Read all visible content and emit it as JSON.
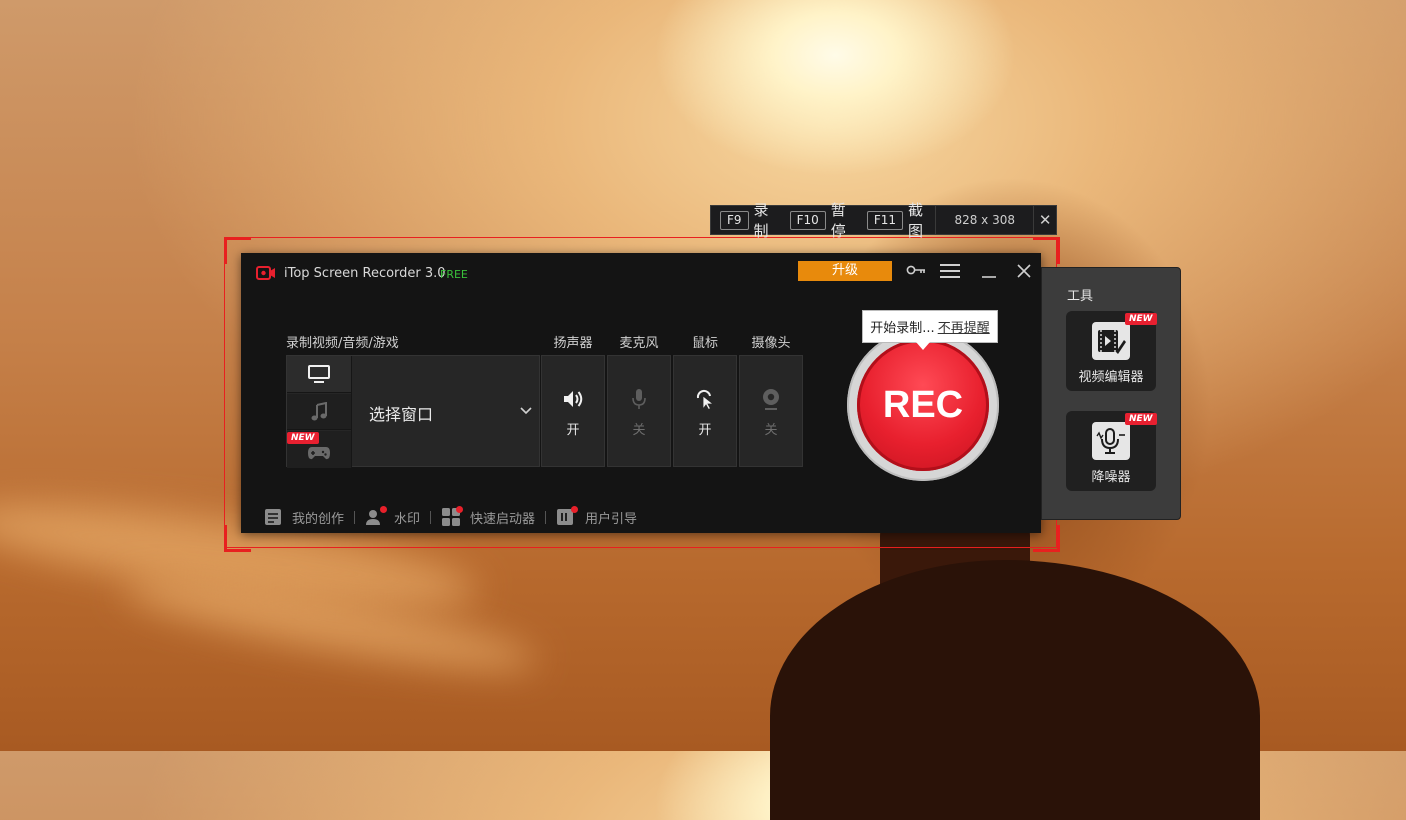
{
  "hotkey_bar": {
    "items": [
      {
        "key": "F9",
        "label": "录制"
      },
      {
        "key": "F10",
        "label": "暂停"
      },
      {
        "key": "F11",
        "label": "截图"
      }
    ],
    "dimensions": "828 x 308",
    "close_glyph": "✕"
  },
  "window": {
    "title": "iTop Screen Recorder 3.0",
    "badge": "FREE",
    "upgrade_label": "升级",
    "mode_label": "录制视频/音频/游戏",
    "select_label": "选择窗口",
    "new_tag": "NEW",
    "devices": [
      {
        "name": "扬声器",
        "state": "开",
        "on": true,
        "icon": "speaker-icon"
      },
      {
        "name": "麦克风",
        "state": "关",
        "on": false,
        "icon": "microphone-icon"
      },
      {
        "name": "鼠标",
        "state": "开",
        "on": true,
        "icon": "mouse-click-icon"
      },
      {
        "name": "摄像头",
        "state": "关",
        "on": false,
        "icon": "webcam-icon"
      }
    ],
    "bottom_links": [
      {
        "label": "我的创作",
        "icon": "my-creations-icon"
      },
      {
        "label": "水印",
        "icon": "watermark-icon"
      },
      {
        "label": "快速启动器",
        "icon": "quick-launcher-icon"
      },
      {
        "label": "用户引导",
        "icon": "user-guide-icon"
      }
    ]
  },
  "rec": {
    "label": "REC",
    "tooltip_text": "开始录制...",
    "tooltip_link": "不再提醒"
  },
  "tools": {
    "title": "工具",
    "items": [
      {
        "label": "视频编辑器",
        "new": "NEW",
        "icon": "video-editor-icon"
      },
      {
        "label": "降噪器",
        "new": "NEW",
        "icon": "noise-reducer-icon"
      }
    ]
  },
  "colors": {
    "accent_red": "#e8202e",
    "upgrade_orange": "#e88a0c",
    "free_green": "#39c13a",
    "selection_red": "#e8201f"
  }
}
